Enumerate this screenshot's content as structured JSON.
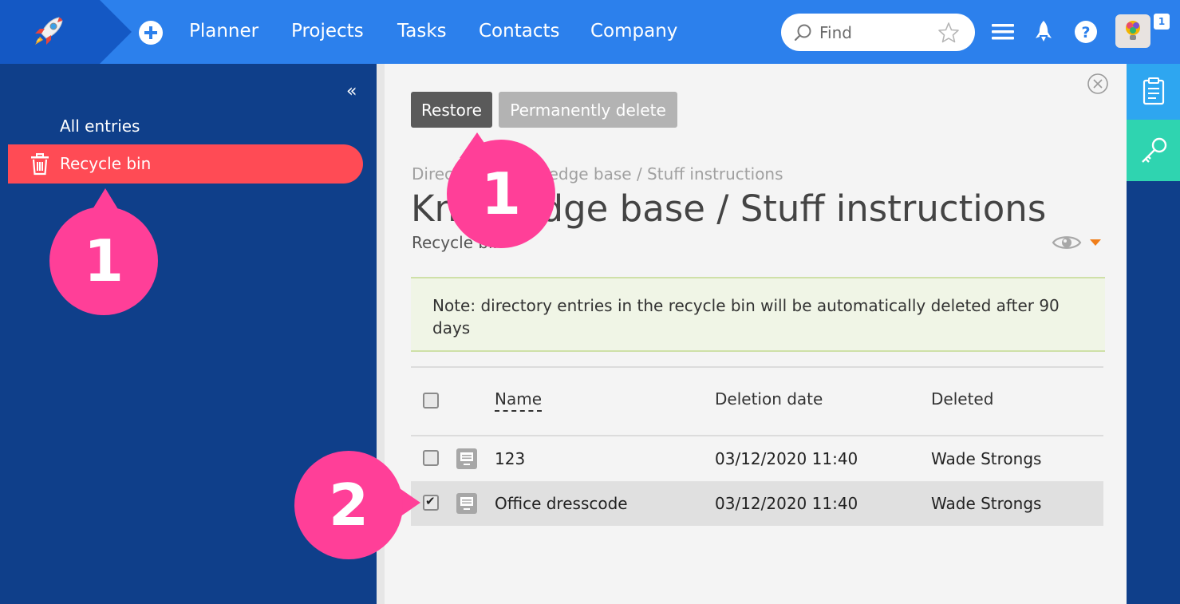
{
  "topbar": {
    "nav": [
      "Planner",
      "Projects",
      "Tasks",
      "Contacts",
      "Company"
    ],
    "search_placeholder": "Find",
    "notifications_count": "1",
    "colors": {
      "bar": "#2c80ec",
      "logo_bg": "#1458c4"
    }
  },
  "sidebar": {
    "collapse_glyph": "«",
    "all_entries": "All entries",
    "recycle_bin": "Recycle bin",
    "colors": {
      "bg": "#0f3f8a",
      "active": "#ff4b55"
    }
  },
  "toolbar": {
    "restore": "Restore",
    "permanently_delete": "Permanently delete"
  },
  "page": {
    "breadcrumb": "Directory / Knowledge base / Stuff instructions",
    "title": "Knowledge base / Stuff instructions",
    "subtitle": "Recycle bin"
  },
  "note": {
    "text": "Note: directory entries in the recycle bin will be automatically deleted after 90 days"
  },
  "table": {
    "headers": {
      "name": "Name",
      "deletion_date": "Deletion date",
      "deleted": "Deleted"
    },
    "rows": [
      {
        "name": "123",
        "deletion_date": "03/12/2020 11:40",
        "deleted": "Wade Strongs",
        "checked": false
      },
      {
        "name": "Office dresscode",
        "deletion_date": "03/12/2020 11:40",
        "deleted": "Wade Strongs",
        "checked": true
      }
    ]
  },
  "callouts": {
    "sidebar": "1",
    "restore": "1",
    "row": "2",
    "color": "#ff3f98"
  },
  "icons": [
    "rocket-icon",
    "plus-icon",
    "search-icon",
    "star-icon",
    "menu-icon",
    "launch-icon",
    "help-icon",
    "avatar",
    "trash-icon",
    "close-icon",
    "eye-icon",
    "document-icon",
    "clipboard-icon",
    "key-icon"
  ]
}
